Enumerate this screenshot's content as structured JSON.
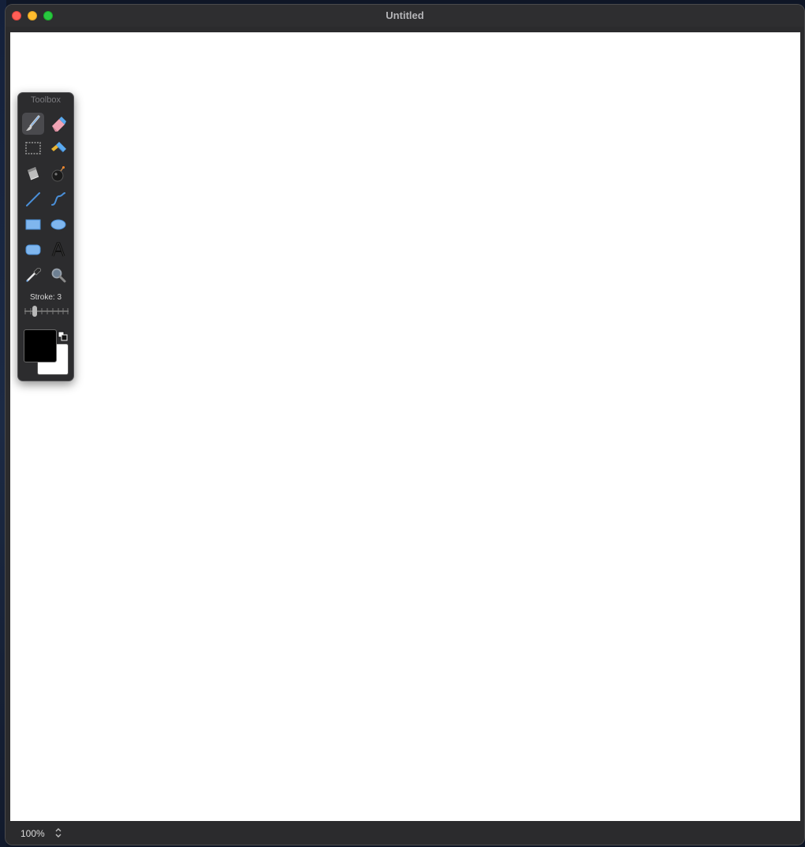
{
  "window": {
    "title": "Untitled"
  },
  "toolbox": {
    "title": "Toolbox",
    "tools": [
      {
        "name": "paintbrush",
        "selected": true
      },
      {
        "name": "eraser",
        "selected": false
      },
      {
        "name": "rectangle-select",
        "selected": false
      },
      {
        "name": "lasso",
        "selected": false
      },
      {
        "name": "paint-bucket",
        "selected": false
      },
      {
        "name": "spray-bomb",
        "selected": false
      },
      {
        "name": "line",
        "selected": false
      },
      {
        "name": "curve",
        "selected": false
      },
      {
        "name": "rectangle",
        "selected": false
      },
      {
        "name": "ellipse",
        "selected": false
      },
      {
        "name": "rounded-rectangle",
        "selected": false
      },
      {
        "name": "text",
        "selected": false
      },
      {
        "name": "eyedropper",
        "selected": false
      },
      {
        "name": "magnifier",
        "selected": false
      }
    ],
    "stroke_label": "Stroke: 3",
    "stroke_value": 3,
    "foreground_color": "#000000",
    "background_color": "#ffffff"
  },
  "statusbar": {
    "zoom": "100%"
  },
  "colors": {
    "titlebar": "#2e2e30",
    "canvas": "#ffffff",
    "tool_selected": "#4a4a4e"
  }
}
